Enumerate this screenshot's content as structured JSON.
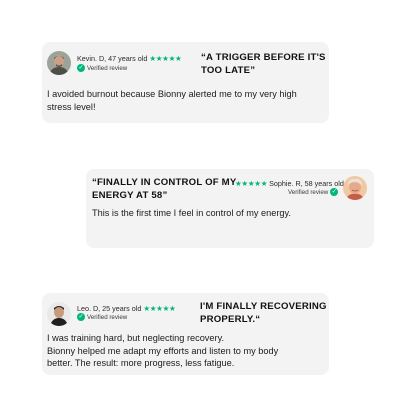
{
  "colors": {
    "card": "#f3f3f4",
    "star": "#00b67a",
    "verified": "#00b67a"
  },
  "reviews": [
    {
      "name": "Kevin. D, 47 years old",
      "stars": "★★★★★",
      "verified": "Verified review",
      "headline_line1": "“A TRIGGER BEFORE IT'S",
      "headline_line2": "TOO LATE”",
      "body_line1": "I avoided burnout because Bionny alerted me to my very high",
      "body_line2": "stress level!"
    },
    {
      "name": "Sophie. R, 58 years old",
      "stars": "★★★★★",
      "verified": "Verified review",
      "headline_line1": "“FINALLY IN CONTROL OF MY",
      "headline_line2": "ENERGY AT 58”",
      "body_line1": "This is the first time I feel in control of my energy."
    },
    {
      "name": "Leo. D, 25 years old",
      "stars": "★★★★★",
      "verified": "Verified review",
      "headline_line1": "I'M FINALLY RECOVERING",
      "headline_line2": "PROPERLY.“",
      "body_line1": "I was training hard, but neglecting recovery.",
      "body_line2": "Bionny helped me adapt my efforts and listen to my body",
      "body_line3": "better. The result: more progress, less fatigue."
    }
  ]
}
